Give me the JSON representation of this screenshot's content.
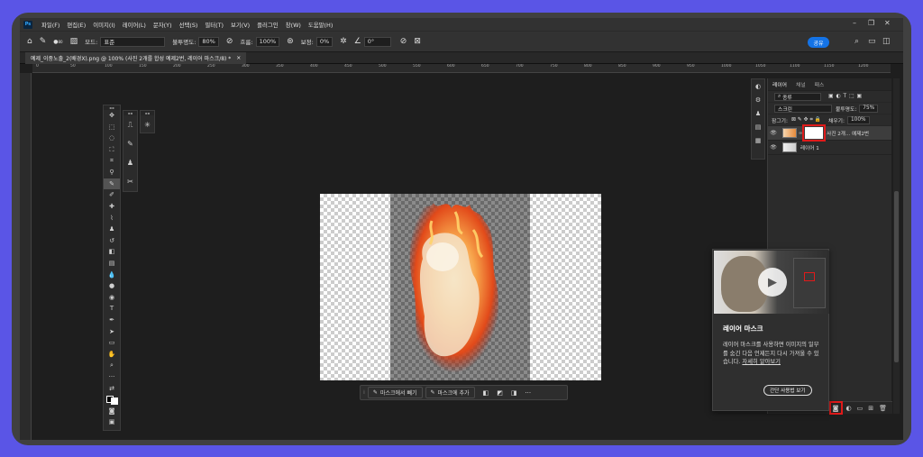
{
  "app": {
    "logo": "Ps"
  },
  "menu": [
    "파일(F)",
    "편집(E)",
    "이미지(I)",
    "레이어(L)",
    "문자(Y)",
    "선택(S)",
    "필터(T)",
    "보기(V)",
    "플러그인",
    "창(W)",
    "도움말(H)"
  ],
  "options": {
    "mode_label": "모드:",
    "mode_value": "표준",
    "opacity_label": "불투명도:",
    "opacity_value": "80%",
    "flow_label": "흐름:",
    "flow_value": "100%",
    "smooth_label": "보정:",
    "smooth_value": "0%",
    "angle_value": "0°",
    "brush_size": "80",
    "share_label": "공유"
  },
  "document_tab": {
    "title": "예제_이중노출_2(배경X).png @ 100% (사진 2개를 합성 예제2번, 레이어 마스크/8) *",
    "close": "×"
  },
  "ruler": {
    "ticks": [
      "0",
      "50",
      "100",
      "150",
      "200",
      "250",
      "300",
      "350",
      "400",
      "450",
      "500",
      "550",
      "600",
      "650",
      "700",
      "750",
      "800",
      "850",
      "900",
      "950",
      "1000",
      "1050",
      "1100",
      "1150",
      "1200"
    ]
  },
  "taskbar": {
    "subtract_label": "마스크에서 빼기",
    "add_label": "마스크에 추가",
    "more": "···"
  },
  "layers_panel": {
    "tabs": [
      "레이어",
      "채널",
      "패스"
    ],
    "filter_label": "종류",
    "blend_mode": "스크린",
    "opacity_label": "불투명도:",
    "opacity_value": "75%",
    "lock_label": "잠그기:",
    "fill_label": "채우기:",
    "fill_value": "100%",
    "layers": [
      {
        "name": "사진 2개... 예제2번"
      },
      {
        "name": "레이어 1"
      }
    ]
  },
  "tip_card": {
    "title": "레이어 마스크",
    "body": "레이어 마스크를 사용하면 이미지의 일부를 숨긴 다음 언제든지 다시 가져올 수 있습니다.",
    "link": "자세히 알아보기",
    "button": "간단 사용법 보기"
  },
  "colors": {
    "accent": "#1473e6",
    "highlight": "#e01a1a",
    "outer": "#5a55e6"
  }
}
